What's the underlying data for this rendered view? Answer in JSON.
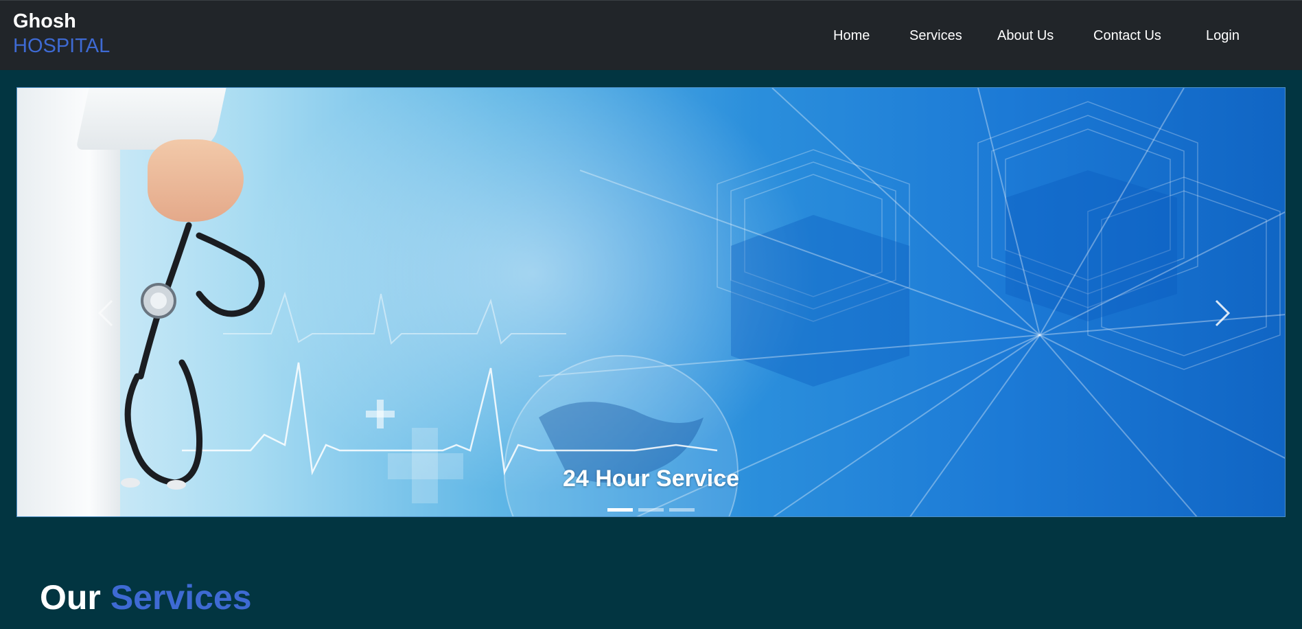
{
  "brand": {
    "line1": "Ghosh",
    "line2": "HOSPITAL"
  },
  "nav": {
    "items": [
      {
        "label": "Home"
      },
      {
        "label": "Services"
      },
      {
        "label": "About Us"
      },
      {
        "label": "Contact Us"
      },
      {
        "label": "Login"
      }
    ]
  },
  "carousel": {
    "caption": "24 Hour Service",
    "slide_count": 3,
    "active_slide": 1,
    "prev_icon": "chevron-left-icon",
    "next_icon": "chevron-right-icon"
  },
  "services_heading": {
    "word1": "Our",
    "word2": "Services"
  },
  "colors": {
    "navbar_bg": "#212529",
    "page_bg": "#023541",
    "accent": "#3e6ad3",
    "text": "#ffffff"
  }
}
